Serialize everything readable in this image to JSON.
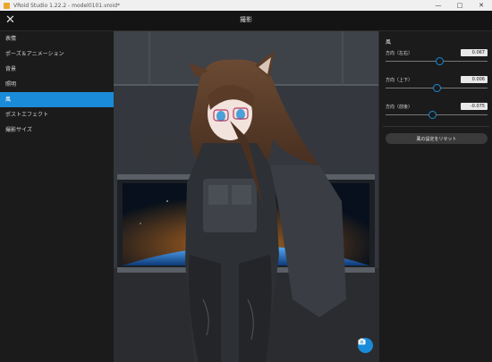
{
  "window": {
    "title": "VRoid Studio 1.22.2 - model0101.vroid*",
    "minimize": "—",
    "maximize": "□",
    "close": "✕"
  },
  "header": {
    "close_icon": "✕",
    "title": "撮影"
  },
  "sidebar": {
    "items": [
      {
        "label": "表情",
        "active": false
      },
      {
        "label": "ポーズ＆アニメーション",
        "active": false
      },
      {
        "label": "背景",
        "active": false
      },
      {
        "label": "照明",
        "active": false
      },
      {
        "label": "風",
        "active": true
      },
      {
        "label": "ポストエフェクト",
        "active": false
      },
      {
        "label": "撮影サイズ",
        "active": false
      }
    ]
  },
  "panel": {
    "section_title": "風",
    "params": [
      {
        "label": "方向（左右）",
        "value": "0.067",
        "level": 0.533
      },
      {
        "label": "方向（上下）",
        "value": "0.006",
        "level": 0.503
      },
      {
        "label": "方向（前後）",
        "value": "-0.075",
        "level": 0.463
      }
    ],
    "reset_label": "風の設定をリセット"
  },
  "viewport": {
    "camera_icon": "camera-icon"
  },
  "colors": {
    "accent": "#1a8bd8",
    "background": "#1b1b1b"
  }
}
